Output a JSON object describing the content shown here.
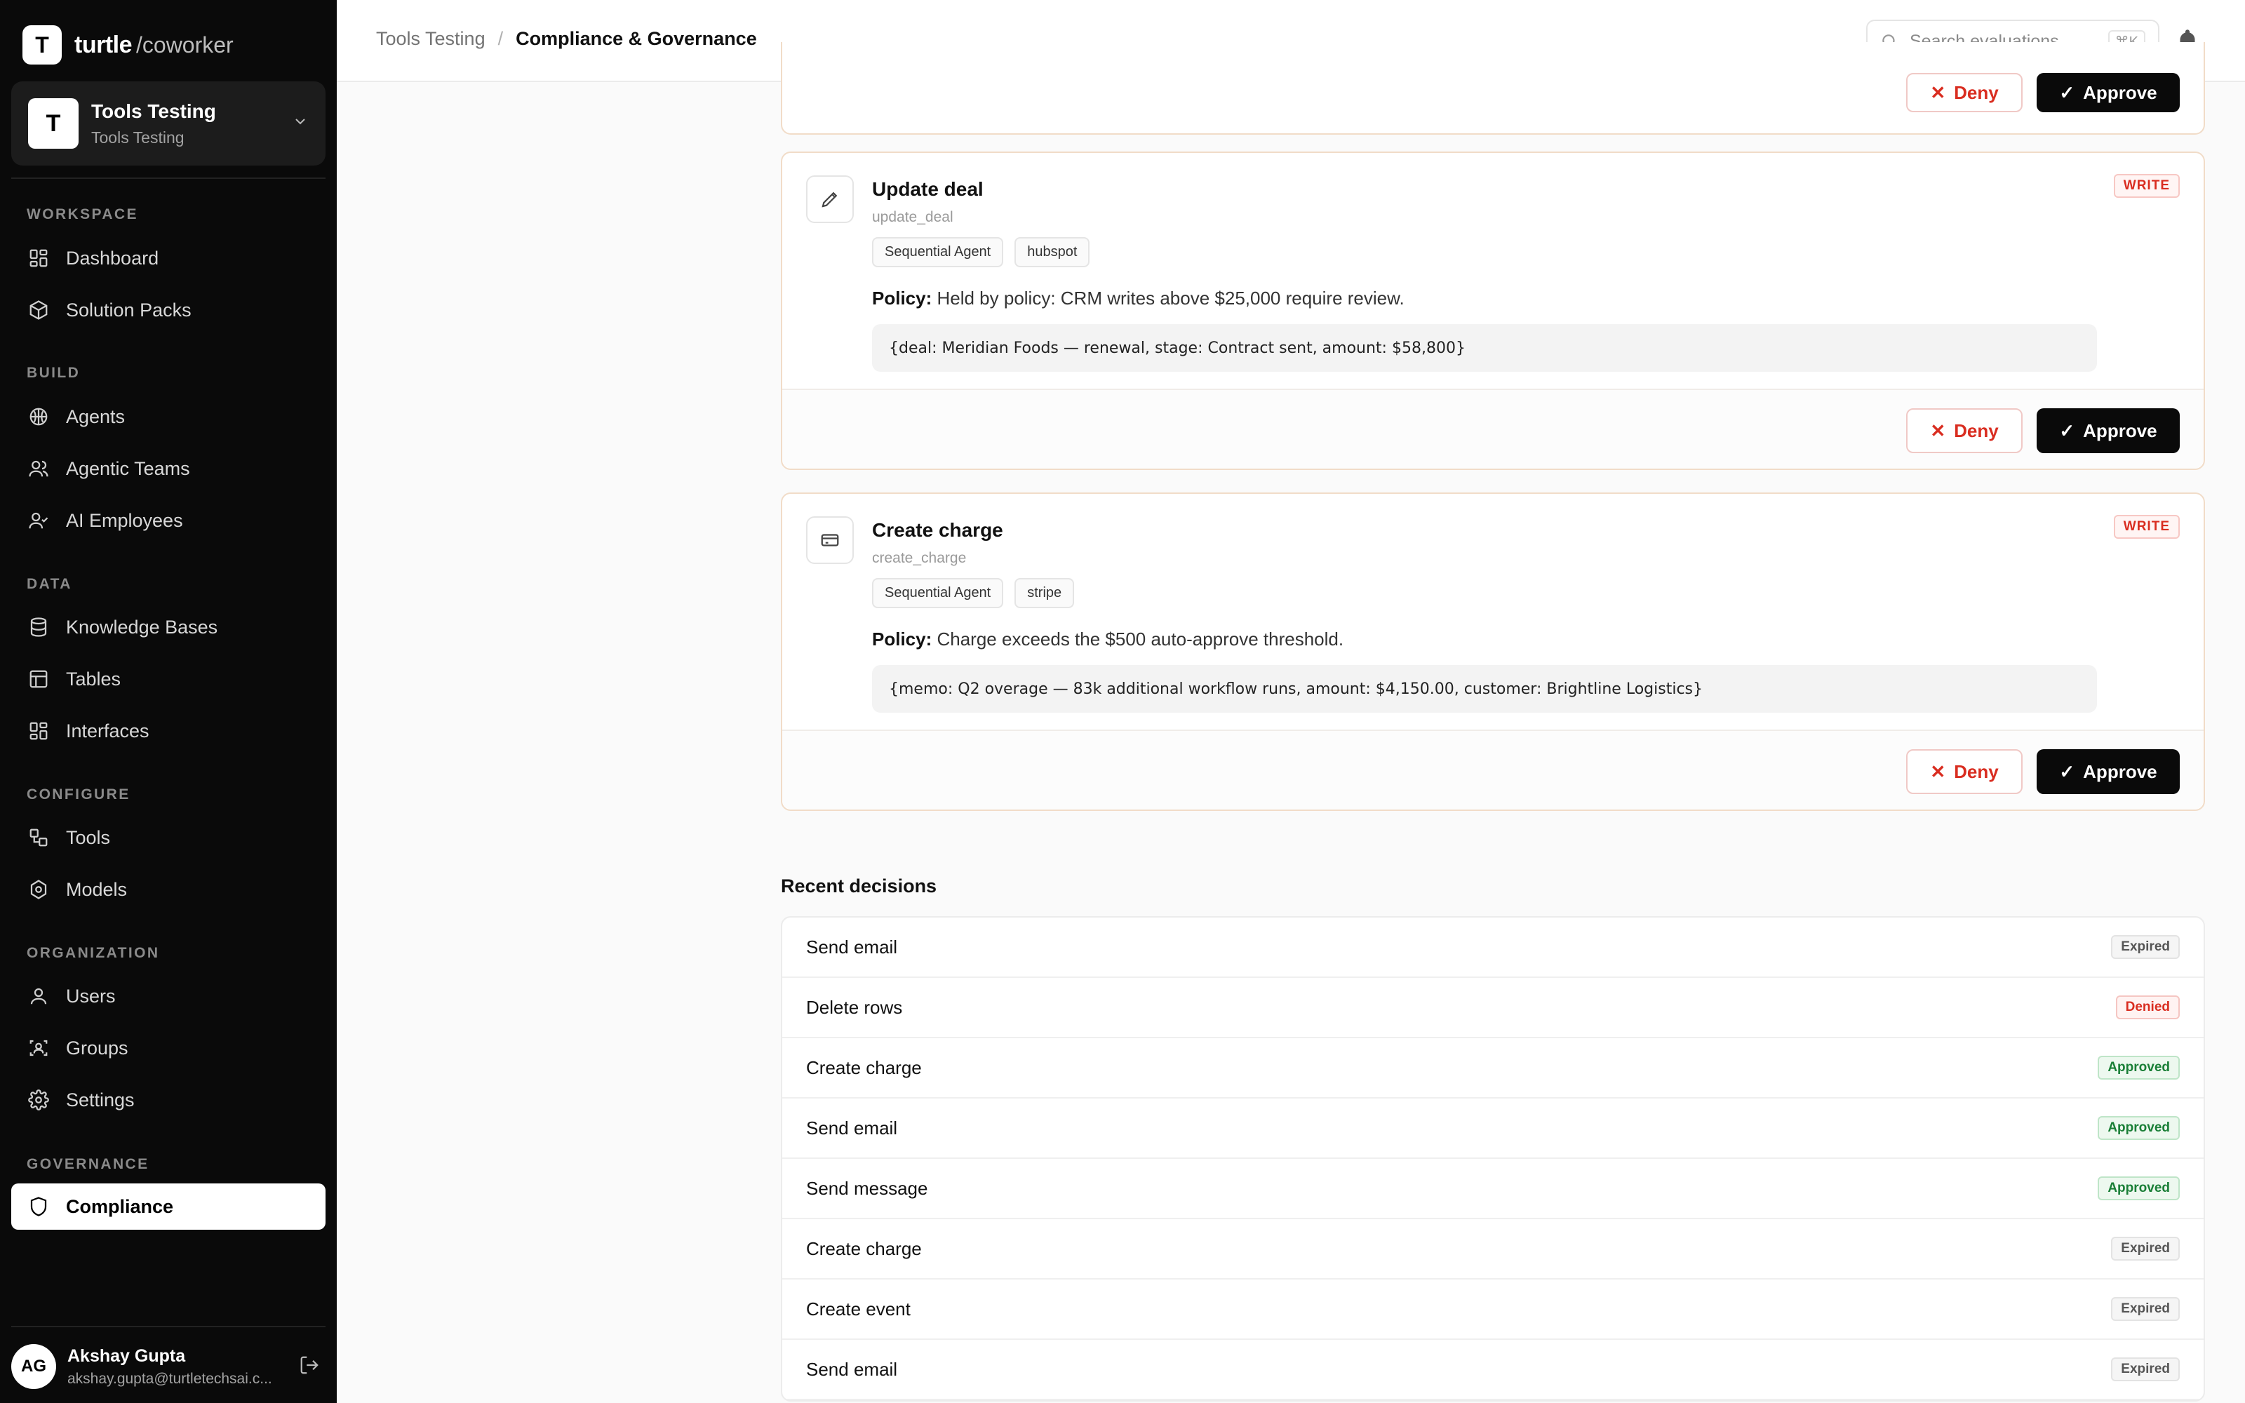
{
  "brand": {
    "logo_letter": "T",
    "name": "turtle",
    "suffix": "/coworker"
  },
  "workspace": {
    "avatar_letter": "T",
    "title": "Tools Testing",
    "subtitle": "Tools Testing"
  },
  "sidebar": {
    "sections": {
      "workspace": "WORKSPACE",
      "build": "BUILD",
      "data": "DATA",
      "configure": "CONFIGURE",
      "organization": "ORGANIZATION",
      "governance": "GOVERNANCE"
    },
    "items": {
      "dashboard": "Dashboard",
      "solution_packs": "Solution Packs",
      "agents": "Agents",
      "agentic_teams": "Agentic Teams",
      "ai_employees": "AI Employees",
      "knowledge_bases": "Knowledge Bases",
      "tables": "Tables",
      "interfaces": "Interfaces",
      "tools": "Tools",
      "models": "Models",
      "users": "Users",
      "groups": "Groups",
      "settings": "Settings",
      "compliance": "Compliance"
    }
  },
  "user": {
    "initials": "AG",
    "name": "Akshay Gupta",
    "email": "akshay.gupta@turtletechsai.c..."
  },
  "header": {
    "breadcrumb": [
      "Tools Testing",
      "Compliance & Governance"
    ],
    "search_placeholder": "Search evaluations",
    "search_shortcut": "⌘K"
  },
  "buttons": {
    "deny": "Deny",
    "approve": "Approve"
  },
  "pending": [
    {
      "title": "Update deal",
      "tool_id": "update_deal",
      "icon": "pen-icon",
      "tags": [
        "Sequential Agent",
        "hubspot"
      ],
      "badge": "WRITE",
      "policy_label": "Policy:",
      "policy_text": "Held by policy: CRM writes above $25,000 require review.",
      "args": "{deal: Meridian Foods — renewal, stage: Contract sent, amount: $58,800}"
    },
    {
      "title": "Create charge",
      "tool_id": "create_charge",
      "icon": "credit-card-icon",
      "tags": [
        "Sequential Agent",
        "stripe"
      ],
      "badge": "WRITE",
      "policy_label": "Policy:",
      "policy_text": "Charge exceeds the $500 auto-approve threshold.",
      "args": "{memo: Q2 overage — 83k additional workflow runs, amount: $4,150.00, customer: Brightline Logistics}"
    }
  ],
  "recent": {
    "title": "Recent decisions",
    "rows": [
      {
        "name": "Send email",
        "status": "Expired"
      },
      {
        "name": "Delete rows",
        "status": "Denied"
      },
      {
        "name": "Create charge",
        "status": "Approved"
      },
      {
        "name": "Send email",
        "status": "Approved"
      },
      {
        "name": "Send message",
        "status": "Approved"
      },
      {
        "name": "Create charge",
        "status": "Expired"
      },
      {
        "name": "Create event",
        "status": "Expired"
      },
      {
        "name": "Send email",
        "status": "Expired"
      }
    ]
  },
  "colors": {
    "sidebar_bg": "#0a0a0a",
    "accent_deny": "#d92d20",
    "accent_approved": "#1a7f37",
    "card_border": "#f1dcc8"
  }
}
